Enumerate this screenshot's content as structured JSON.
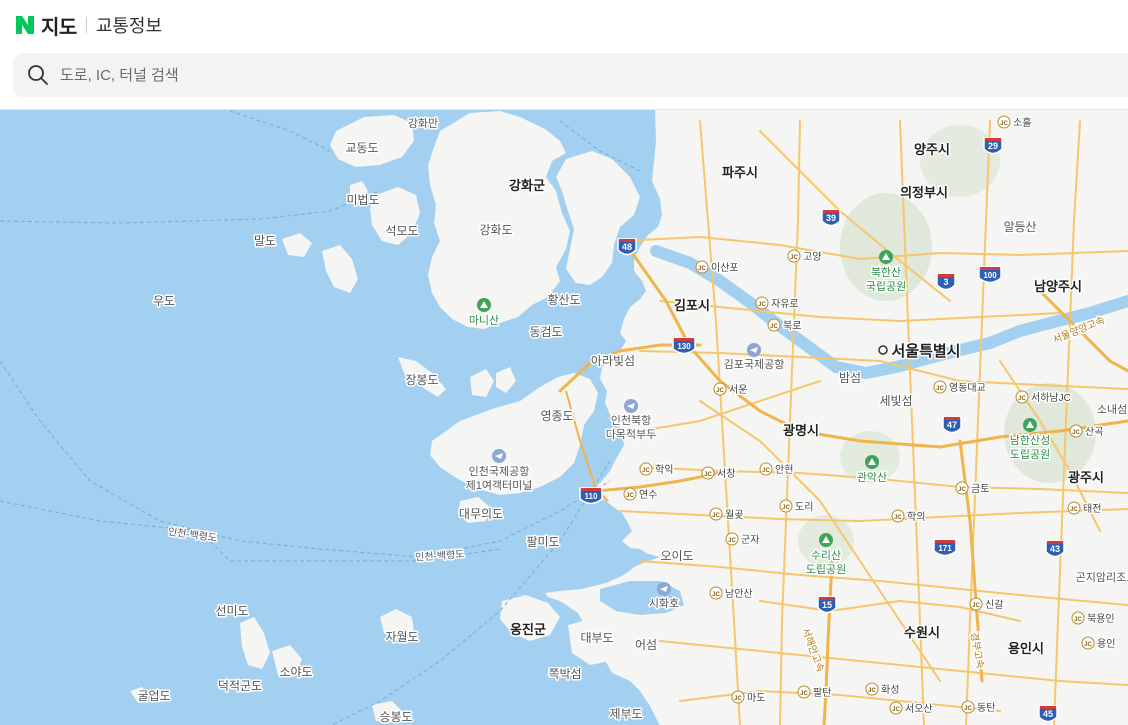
{
  "header": {
    "logo_text": "지도",
    "sub_title": "교통정보"
  },
  "search": {
    "placeholder": "도로, IC, 터널 검색"
  },
  "map": {
    "colors": {
      "water": "#a3d0f1",
      "land": "#f5f5f3",
      "road": "#f6c66a",
      "highway_shield": "#2f5fb4"
    },
    "place_labels": [
      {
        "id": "gangwha-man",
        "text": "강화만"
      },
      {
        "id": "gyodong-do",
        "text": "교동도"
      },
      {
        "id": "ganghwa-gun",
        "text": "강화군"
      },
      {
        "id": "mibeop-do",
        "text": "미법도"
      },
      {
        "id": "seokmo-do",
        "text": "석모도"
      },
      {
        "id": "ganghwa-do",
        "text": "강화도"
      },
      {
        "id": "mal-do",
        "text": "말도"
      },
      {
        "id": "u-do",
        "text": "우도"
      },
      {
        "id": "hwangsan-do",
        "text": "황산도"
      },
      {
        "id": "dongeom-do",
        "text": "동검도"
      },
      {
        "id": "ara-bitseom",
        "text": "아라빛섬"
      },
      {
        "id": "jangbong-do",
        "text": "장봉도"
      },
      {
        "id": "yeongjong-do",
        "text": "영종도"
      },
      {
        "id": "daemuui-do",
        "text": "대무의도"
      },
      {
        "id": "palmi-do",
        "text": "팔미도"
      },
      {
        "id": "seonmi-do",
        "text": "선미도"
      },
      {
        "id": "jawol-do",
        "text": "자월도"
      },
      {
        "id": "ongjin-gun",
        "text": "옹진군"
      },
      {
        "id": "daebu-do",
        "text": "대부도"
      },
      {
        "id": "soya-do",
        "text": "소야도"
      },
      {
        "id": "deokjeok-gundo",
        "text": "덕적군도"
      },
      {
        "id": "gureop-do",
        "text": "굴업도"
      },
      {
        "id": "jjokbak-seom",
        "text": "쪽박섬"
      },
      {
        "id": "seungbong-do",
        "text": "승봉도"
      },
      {
        "id": "jebu-do",
        "text": "제부도"
      },
      {
        "id": "eoseom",
        "text": "어섬"
      },
      {
        "id": "oi-do",
        "text": "오이도"
      },
      {
        "id": "paju-si",
        "text": "파주시"
      },
      {
        "id": "yangju-si",
        "text": "양주시"
      },
      {
        "id": "uijeongbu-si",
        "text": "의정부시"
      },
      {
        "id": "aldeungsan",
        "text": "알등산"
      },
      {
        "id": "gimpo-si",
        "text": "김포시"
      },
      {
        "id": "namyangju-si",
        "text": "남양주시"
      },
      {
        "id": "seoul",
        "text": "서울특별시"
      },
      {
        "id": "bamseom",
        "text": "밤섬"
      },
      {
        "id": "sebitseom",
        "text": "세빛섬"
      },
      {
        "id": "soraebong",
        "text": "소내섬"
      },
      {
        "id": "gwangmyeong-si",
        "text": "광명시"
      },
      {
        "id": "gwangju-si",
        "text": "광주시"
      },
      {
        "id": "suwon-si",
        "text": "수원시"
      },
      {
        "id": "yongin-si",
        "text": "용인시"
      },
      {
        "id": "incheon-baengnyeong-1",
        "text": "인천-백령도"
      },
      {
        "id": "incheon-baengnyeong-2",
        "text": "인천-백령도"
      },
      {
        "id": "gonjiam",
        "text": "곤지암리조트"
      },
      {
        "id": "seoul-yangyang",
        "text": "서울양양고속"
      },
      {
        "id": "seohaean",
        "text": "서해안고속"
      },
      {
        "id": "gyeongbu",
        "text": "경부고속"
      }
    ],
    "parks": [
      {
        "id": "manisan",
        "text": "마니산"
      },
      {
        "id": "bukhansan-1",
        "text": "북한산"
      },
      {
        "id": "bukhansan-2",
        "text": "국립공원"
      },
      {
        "id": "gwanaksan",
        "text": "관악산"
      },
      {
        "id": "namhansanseong-1",
        "text": "남한산성"
      },
      {
        "id": "namhansanseong-2",
        "text": "도립공원"
      },
      {
        "id": "surisan-1",
        "text": "수리산"
      },
      {
        "id": "surisan-2",
        "text": "도립공원"
      }
    ],
    "airports": [
      {
        "id": "incheon-airport-1",
        "text": "인천국제공항"
      },
      {
        "id": "incheon-airport-2",
        "text": "제1여객터미널"
      },
      {
        "id": "gimpo-airport",
        "text": "김포국제공항"
      },
      {
        "id": "incheon-port-1",
        "text": "인천북항"
      },
      {
        "id": "incheon-port-2",
        "text": "다목적부두"
      },
      {
        "id": "sihwaho",
        "text": "시화호"
      }
    ],
    "junctions": [
      {
        "id": "isanpo",
        "text": "이산포"
      },
      {
        "id": "goyang",
        "text": "고양"
      },
      {
        "id": "jayuro",
        "text": "자유로"
      },
      {
        "id": "bukro",
        "text": "북로"
      },
      {
        "id": "seoun",
        "text": "서운"
      },
      {
        "id": "yeongdong",
        "text": "영동대교"
      },
      {
        "id": "seohanam",
        "text": "서하남JC"
      },
      {
        "id": "sanguk",
        "text": "산곡"
      },
      {
        "id": "hakik",
        "text": "학익"
      },
      {
        "id": "seochang",
        "text": "서창"
      },
      {
        "id": "anhyeon",
        "text": "안현"
      },
      {
        "id": "yeonsu",
        "text": "연수"
      },
      {
        "id": "wolgot",
        "text": "월곶"
      },
      {
        "id": "dori",
        "text": "도리"
      },
      {
        "id": "geumto",
        "text": "금토"
      },
      {
        "id": "hakui",
        "text": "학의"
      },
      {
        "id": "gunja",
        "text": "군자"
      },
      {
        "id": "namansan",
        "text": "남안산"
      },
      {
        "id": "taejeon",
        "text": "태전"
      },
      {
        "id": "singal",
        "text": "신갈"
      },
      {
        "id": "bugyongin",
        "text": "북용인"
      },
      {
        "id": "yongin-jc",
        "text": "용인"
      },
      {
        "id": "mado",
        "text": "마도"
      },
      {
        "id": "paltan",
        "text": "팔탄"
      },
      {
        "id": "hwaseong",
        "text": "화성"
      },
      {
        "id": "seoosan",
        "text": "서오산"
      },
      {
        "id": "dongtan",
        "text": "동탄"
      },
      {
        "id": "sohol",
        "text": "소흘"
      }
    ],
    "highway_shields": [
      "29",
      "39",
      "48",
      "3",
      "100",
      "130",
      "47",
      "110",
      "171",
      "43",
      "15",
      "45"
    ]
  }
}
